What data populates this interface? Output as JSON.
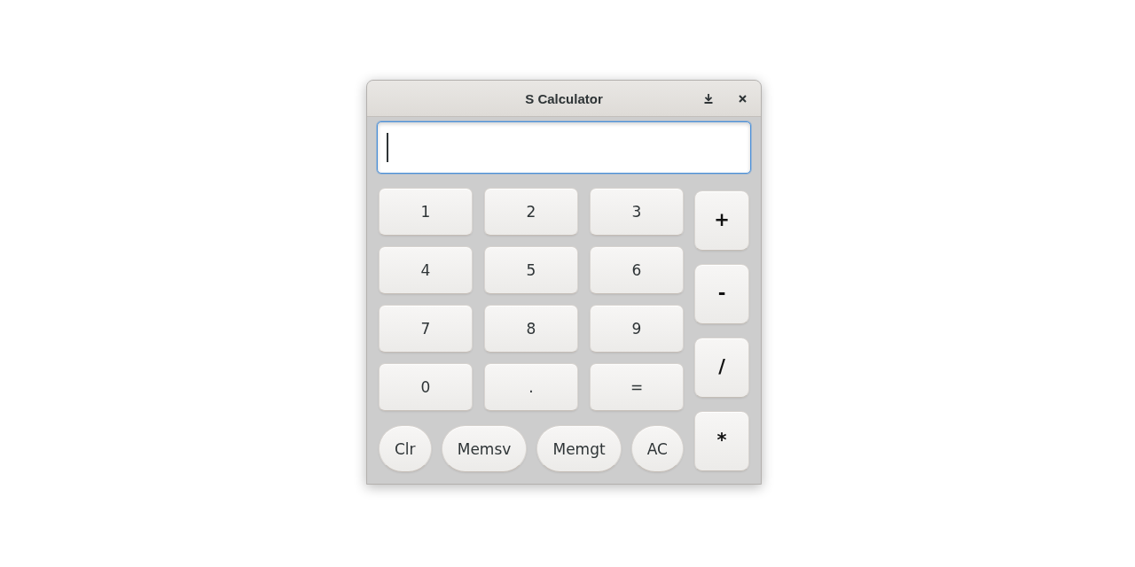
{
  "window": {
    "title": "S Calculator"
  },
  "display": {
    "focused": true
  },
  "keypad": [
    "1",
    "2",
    "3",
    "4",
    "5",
    "6",
    "7",
    "8",
    "9",
    "0",
    ".",
    "="
  ],
  "operators": [
    "+",
    "-",
    "/",
    "*"
  ],
  "function_keys": [
    "Clr",
    "Memsv",
    "Memgt",
    "AC"
  ]
}
